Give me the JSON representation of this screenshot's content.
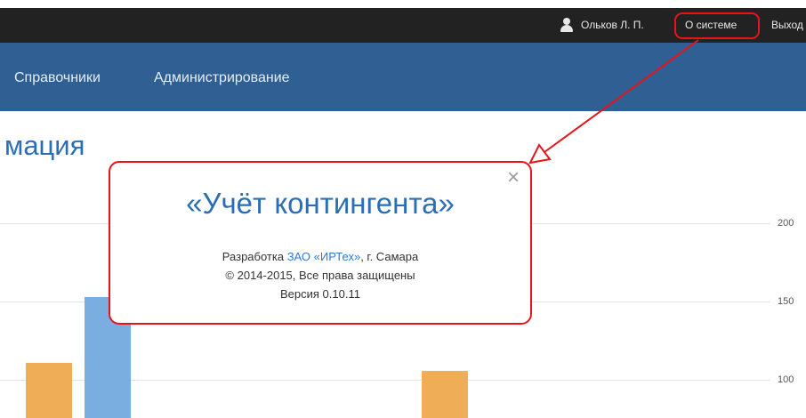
{
  "topbar": {
    "user_name": "Ольков Л. П.",
    "about_label": "О системе",
    "logout_label": "Выход"
  },
  "navbar": {
    "items": [
      {
        "label": "Справочники"
      },
      {
        "label": "Администрирование"
      }
    ]
  },
  "page": {
    "title": "мация"
  },
  "chart": {
    "ticks": [
      "200",
      "150",
      "100"
    ]
  },
  "dialog": {
    "close_symbol": "×",
    "title": "«Учёт контингента»",
    "dev_prefix": "Разработка ",
    "dev_company": "ЗАО «ИРТех»",
    "dev_suffix": ", г. Самара",
    "copyright": "© 2014-2015, Все права защищены",
    "version": "Версия 0.10.11"
  },
  "colors": {
    "highlight": "#e8141b",
    "nav_bg": "#2f5f93",
    "accent": "#2a6fb6",
    "bar_orange": "#f0ad58",
    "bar_blue": "#7aaee0"
  }
}
